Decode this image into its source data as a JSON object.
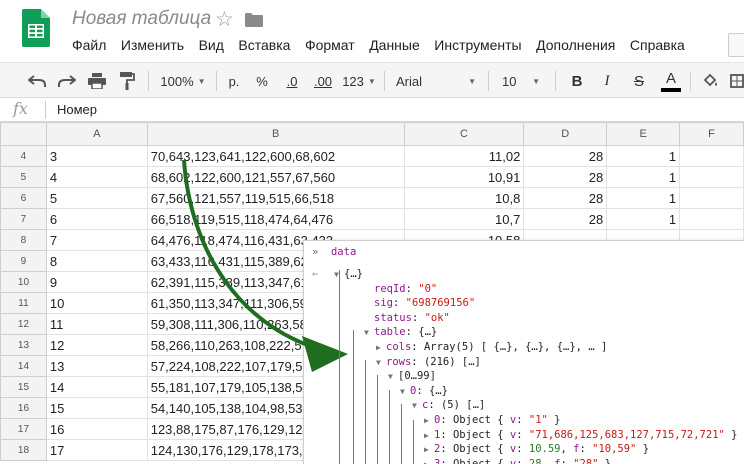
{
  "window": {
    "title": "Новая таблица",
    "star_icon": "star-outline-icon",
    "folder_icon": "folder-icon",
    "logo_icon": "google-sheets-logo-icon"
  },
  "menu": [
    "Файл",
    "Изменить",
    "Вид",
    "Вставка",
    "Формат",
    "Данные",
    "Инструменты",
    "Дополнения",
    "Справка"
  ],
  "toolbar": {
    "zoom": "100%",
    "currency": "р.",
    "percent": "%",
    "dec_less": ".0",
    "dec_more": ".00",
    "more_formats": "123",
    "font": "Arial",
    "font_size": "10",
    "bold": "B",
    "italic": "I",
    "strike": "S",
    "text_color": "A",
    "text_color_value": "#000000"
  },
  "formula_bar": {
    "icon": "fx",
    "value": "Номер"
  },
  "grid": {
    "columns": [
      "A",
      "B",
      "C",
      "D",
      "E",
      "F"
    ],
    "rows": [
      {
        "n": "4",
        "a": "3",
        "b": "70,643,123,641,122,600,68,602",
        "c": "11,02",
        "d": "28",
        "e": "1"
      },
      {
        "n": "5",
        "a": "4",
        "b": "68,602,122,600,121,557,67,560",
        "c": "10,91",
        "d": "28",
        "e": "1"
      },
      {
        "n": "6",
        "a": "5",
        "b": "67,560,121,557,119,515,66,518",
        "c": "10,8",
        "d": "28",
        "e": "1"
      },
      {
        "n": "7",
        "a": "6",
        "b": "66,518,119,515,118,474,64,476",
        "c": "10,7",
        "d": "28",
        "e": "1"
      },
      {
        "n": "8",
        "a": "7",
        "b": "64,476,118,474,116,431,63,433",
        "c": "10,58",
        "d": "",
        "e": ""
      },
      {
        "n": "9",
        "a": "8",
        "b": "63,433,116,431,115,389,62,",
        "c": "",
        "d": "",
        "e": ""
      },
      {
        "n": "10",
        "a": "9",
        "b": "62,391,115,389,113,347,61,",
        "c": "",
        "d": "",
        "e": ""
      },
      {
        "n": "11",
        "a": "10",
        "b": "61,350,113,347,111,306,59,",
        "c": "",
        "d": "",
        "e": ""
      },
      {
        "n": "12",
        "a": "11",
        "b": "59,308,111,306,110,263,58,",
        "c": "",
        "d": "",
        "e": ""
      },
      {
        "n": "13",
        "a": "12",
        "b": "58,266,110,263,108,222,5",
        "c": "",
        "d": "",
        "e": ""
      },
      {
        "n": "14",
        "a": "13",
        "b": "57,224,108,222,107,179,55",
        "c": "",
        "d": "",
        "e": ""
      },
      {
        "n": "15",
        "a": "14",
        "b": "55,181,107,179,105,138,54",
        "c": "",
        "d": "",
        "e": ""
      },
      {
        "n": "16",
        "a": "15",
        "b": "54,140,105,138,104,98,53,",
        "c": "",
        "d": "",
        "e": ""
      },
      {
        "n": "17",
        "a": "16",
        "b": "123,88,175,87,176,129,124",
        "c": "",
        "d": "",
        "e": ""
      },
      {
        "n": "18",
        "a": "17",
        "b": "124,130,176,129,178,173,1",
        "c": "",
        "d": "",
        "e": ""
      }
    ]
  },
  "devtools": {
    "header": "data",
    "lines": [
      {
        "text": "{…}"
      },
      {
        "key": "reqId",
        "val": "\"0\""
      },
      {
        "key": "sig",
        "val": "\"698769156\""
      },
      {
        "key": "status",
        "val": "\"ok\""
      },
      {
        "key": "table",
        "val": "{…}"
      },
      {
        "key": "cols",
        "val": "Array(5) [ {…}, {…}, {…}, … ]"
      },
      {
        "key": "rows",
        "val": "(216) […]"
      },
      {
        "text": "[0…99]"
      },
      {
        "key": "0",
        "val": "{…}"
      },
      {
        "key": "c",
        "val": "(5) […]"
      },
      {
        "key": "0",
        "val": "Object { v: \"1\" }"
      },
      {
        "key": "1",
        "val": "Object { v: \"71,686,125,683,127,715,72,721\" }"
      },
      {
        "key": "2",
        "val": "Object { v: 10.59, f: \"10,59\" }"
      },
      {
        "key": "3",
        "val": "Object { v: 28, f: \"28\" }"
      }
    ]
  },
  "colors": {
    "arrow": "#1f6e1f",
    "sheets_green": "#0f9d58",
    "devtools_key": "#8b1a8b",
    "devtools_string": "#c41a16"
  }
}
